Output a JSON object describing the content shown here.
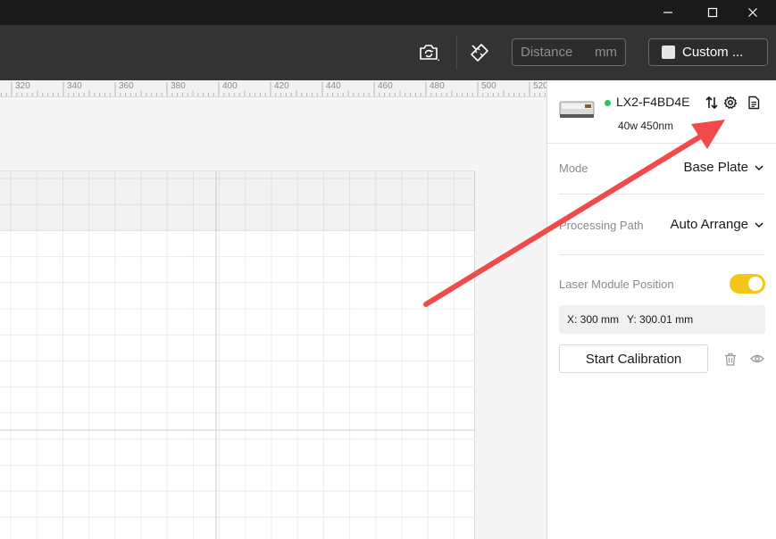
{
  "toolbar": {
    "distance_placeholder": "Distance",
    "distance_unit": "mm",
    "custom_label": "Custom ..."
  },
  "ruler": {
    "labels": [
      "320",
      "340",
      "360",
      "380",
      "400",
      "420",
      "440",
      "460",
      "480",
      "500",
      "520"
    ]
  },
  "device": {
    "name": "LX2-F4BD4E",
    "spec": "40w 450nm",
    "status_color": "#22c55e"
  },
  "settings": {
    "mode_label": "Mode",
    "mode_value": "Base Plate",
    "path_label": "Processing Path",
    "path_value": "Auto Arrange",
    "laser_label": "Laser Module Position",
    "laser_enabled": true,
    "x_coord": "X: 300 mm",
    "y_coord": "Y: 300.01 mm",
    "calibration_label": "Start Calibration"
  },
  "colors": {
    "accent": "#f5c518",
    "arrow": "#f04a4a"
  }
}
